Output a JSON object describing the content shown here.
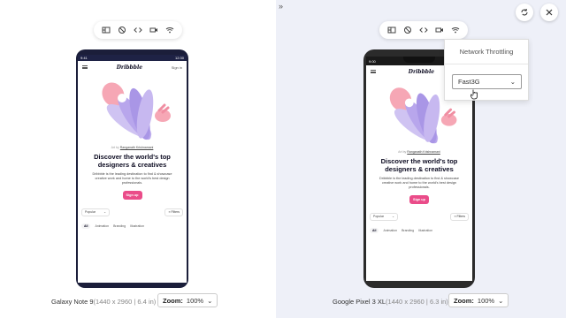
{
  "toolbar": {
    "icons": [
      "screenshot-icon",
      "block-icon",
      "code-icon",
      "video-icon",
      "wifi-icon"
    ]
  },
  "panel_toggle": "»",
  "site": {
    "logo": "Dribbble",
    "sign_in": "Sign in",
    "byline_prefix": "Art by",
    "byline_author": "Ranganath Krishnamani",
    "headline": "Discover the world's top designers & creatives",
    "description": "Dribbble is the leading destination to find & showcase creative work and home to the world's best design professionals.",
    "signup": "Sign up",
    "sort": "Popular",
    "filters": "Filters",
    "categories": [
      "All",
      "Animation",
      "Branding",
      "Illustration"
    ]
  },
  "status": {
    "note9_left": "9:41",
    "note9_right": "12:30",
    "pixel_left": "9:00"
  },
  "devices": [
    {
      "name": "Galaxy Note 9",
      "spec": "(1440 x 2960 | 6.4 in)",
      "zoom_label": "Zoom:",
      "zoom_value": "100%"
    },
    {
      "name": "Google Pixel 3 XL",
      "spec": "(1440 x 2960 | 6.3 in)",
      "zoom_label": "Zoom:",
      "zoom_value": "100%"
    }
  ],
  "throttle": {
    "title": "Network Throttling",
    "value": "Fast3G"
  },
  "colors": {
    "accent": "#ea4c89",
    "right_pane_bg": "#eef0f8",
    "note9_frame": "#1b1e3a",
    "pixel_frame": "#2b2b2b"
  }
}
